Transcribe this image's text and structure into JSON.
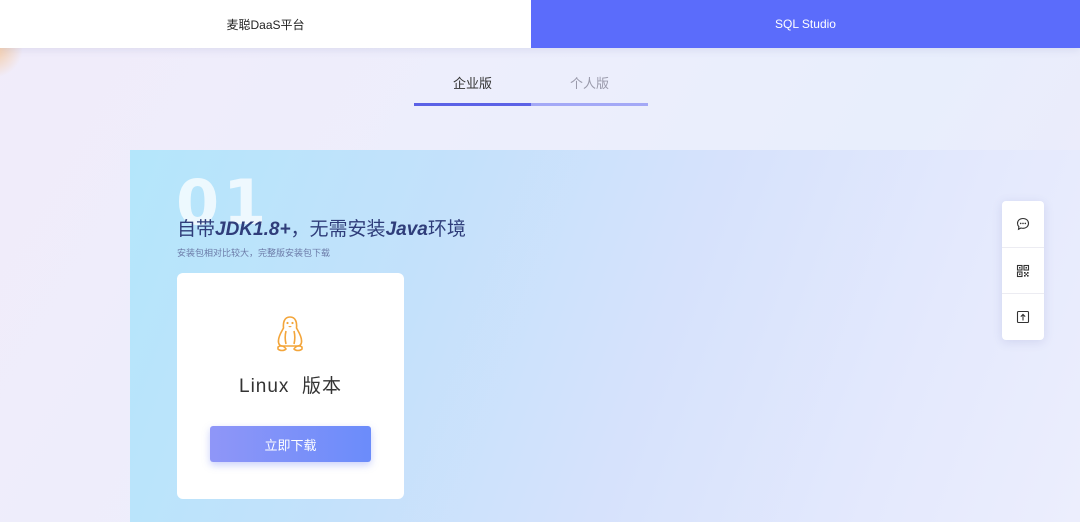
{
  "header": {
    "tabs": [
      {
        "label": "麦聪DaaS平台",
        "active": false
      },
      {
        "label": "SQL Studio",
        "active": true
      }
    ]
  },
  "edition_tabs": [
    {
      "label": "企业版",
      "active": true
    },
    {
      "label": "个人版",
      "active": false
    }
  ],
  "feature": {
    "number": "01",
    "title_prefix": "自带",
    "title_jdk": "JDK1.8+",
    "title_middle": "，无需安装",
    "title_java": "Java",
    "title_suffix": "环境",
    "subtitle": "安装包相对比较大，完整版安装包下载"
  },
  "card": {
    "icon": "linux-penguin-icon",
    "title": "Linux  版本",
    "button_label": "立即下载"
  },
  "side_toolbar": {
    "icons": [
      "chat-icon",
      "qr-code-icon",
      "back-to-top-icon"
    ]
  },
  "colors": {
    "accent": "#5b6cfb",
    "tab_underline": "#5b61e6",
    "penguin": "#f3a53a"
  }
}
